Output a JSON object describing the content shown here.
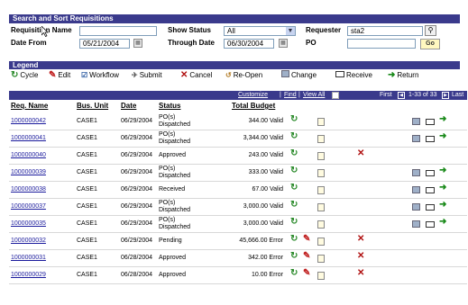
{
  "search": {
    "title": "Search and Sort Requisitions",
    "req_name_label": "Requisition Name",
    "req_name_value": "",
    "show_status_label": "Show Status",
    "show_status_value": "All",
    "requester_label": "Requester",
    "requester_value": "sta2",
    "date_from_label": "Date From",
    "date_from_value": "05/21/2004",
    "through_date_label": "Through Date",
    "through_date_value": "06/30/2004",
    "po_label": "PO",
    "po_value": "",
    "go_label": "Go",
    "search_icon": "magnifier-icon",
    "calendar_icon": "calendar-icon"
  },
  "legend": {
    "title": "Legend",
    "items": [
      {
        "icon": "cycle-icon",
        "label": "Cycle"
      },
      {
        "icon": "edit-icon",
        "label": "Edit"
      },
      {
        "icon": "workflow-icon",
        "label": "Workflow"
      },
      {
        "icon": "submit-icon",
        "label": "Submit"
      },
      {
        "icon": "cancel-icon",
        "label": "Cancel"
      },
      {
        "icon": "reopen-icon",
        "label": "Re-Open"
      },
      {
        "icon": "change-icon",
        "label": "Change"
      },
      {
        "icon": "receive-icon",
        "label": "Receive"
      },
      {
        "icon": "return-icon",
        "label": "Return"
      }
    ]
  },
  "grid": {
    "customize": "Customize",
    "find": "Find",
    "view_all": "View All",
    "first": "First",
    "range": "1-33 of 33",
    "last": "Last",
    "columns": [
      "Req. Name",
      "Bus. Unit",
      "Date",
      "Status",
      "Total Budget"
    ],
    "rows": [
      {
        "name": "1000000042",
        "unit": "CASE1",
        "date": "06/29/2004",
        "status1": "PO(s)",
        "status2": "Dispatched",
        "budget": "344.00 Valid",
        "cycle": true,
        "edit": false,
        "workflow": true,
        "cancel": false,
        "change": true,
        "receive": true,
        "ret": true
      },
      {
        "name": "1000000041",
        "unit": "CASE1",
        "date": "06/29/2004",
        "status1": "PO(s)",
        "status2": "Dispatched",
        "budget": "3,344.00 Valid",
        "cycle": true,
        "edit": false,
        "workflow": true,
        "cancel": false,
        "change": true,
        "receive": true,
        "ret": true
      },
      {
        "name": "1000000040",
        "unit": "CASE1",
        "date": "06/29/2004",
        "status1": "Approved",
        "status2": "",
        "budget": "243.00 Valid",
        "cycle": true,
        "edit": false,
        "workflow": true,
        "cancel": true,
        "change": false,
        "receive": false,
        "ret": false
      },
      {
        "name": "1000000039",
        "unit": "CASE1",
        "date": "06/29/2004",
        "status1": "PO(s)",
        "status2": "Dispatched",
        "budget": "333.00 Valid",
        "cycle": true,
        "edit": false,
        "workflow": true,
        "cancel": false,
        "change": true,
        "receive": true,
        "ret": true
      },
      {
        "name": "1000000038",
        "unit": "CASE1",
        "date": "06/29/2004",
        "status1": "Received",
        "status2": "",
        "budget": "67.00 Valid",
        "cycle": true,
        "edit": false,
        "workflow": true,
        "cancel": false,
        "change": true,
        "receive": true,
        "ret": true
      },
      {
        "name": "1000000037",
        "unit": "CASE1",
        "date": "06/29/2004",
        "status1": "PO(s)",
        "status2": "Dispatched",
        "budget": "3,000.00 Valid",
        "cycle": true,
        "edit": false,
        "workflow": true,
        "cancel": false,
        "change": true,
        "receive": true,
        "ret": true
      },
      {
        "name": "1000000035",
        "unit": "CASE1",
        "date": "06/29/2004",
        "status1": "PO(s)",
        "status2": "Dispatched",
        "budget": "3,000.00 Valid",
        "cycle": true,
        "edit": false,
        "workflow": true,
        "cancel": false,
        "change": true,
        "receive": true,
        "ret": true
      },
      {
        "name": "1000000032",
        "unit": "CASE1",
        "date": "06/29/2004",
        "status1": "Pending",
        "status2": "",
        "budget": "45,666.00 Error",
        "cycle": true,
        "edit": true,
        "workflow": true,
        "cancel": true,
        "change": false,
        "receive": false,
        "ret": false
      },
      {
        "name": "1000000031",
        "unit": "CASE1",
        "date": "06/28/2004",
        "status1": "Approved",
        "status2": "",
        "budget": "342.00 Error",
        "cycle": true,
        "edit": true,
        "workflow": true,
        "cancel": true,
        "change": false,
        "receive": false,
        "ret": false
      },
      {
        "name": "1000000029",
        "unit": "CASE1",
        "date": "06/28/2004",
        "status1": "Approved",
        "status2": "",
        "budget": "10.00 Error",
        "cycle": true,
        "edit": true,
        "workflow": true,
        "cancel": true,
        "change": false,
        "receive": false,
        "ret": false
      }
    ]
  }
}
